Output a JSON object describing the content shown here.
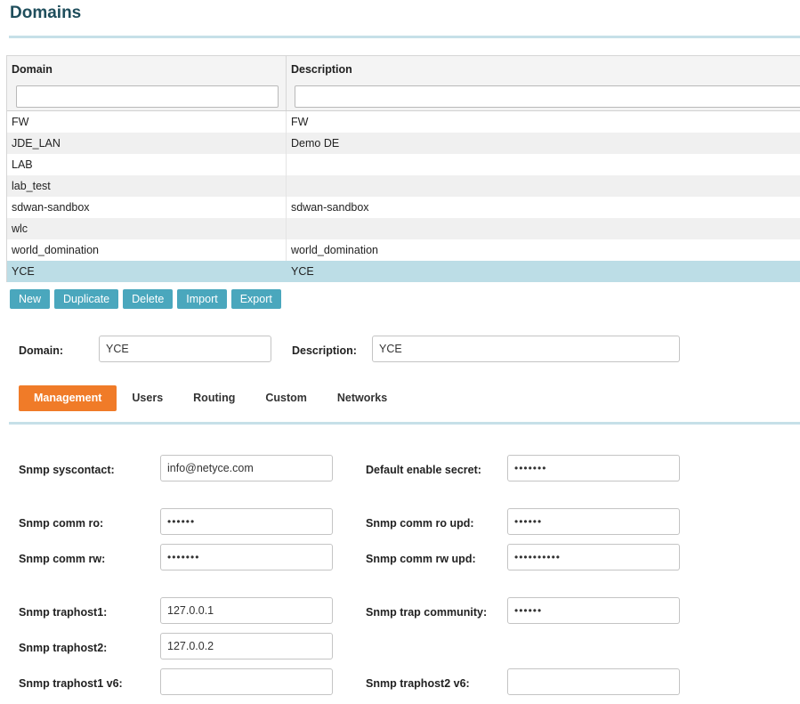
{
  "page": {
    "title": "Domains"
  },
  "grid": {
    "columns": [
      "Domain",
      "Description"
    ],
    "filters": [
      "",
      ""
    ],
    "rows": [
      {
        "domain": "FW",
        "description": "FW"
      },
      {
        "domain": "JDE_LAN",
        "description": "Demo DE"
      },
      {
        "domain": "LAB",
        "description": ""
      },
      {
        "domain": "lab_test",
        "description": ""
      },
      {
        "domain": "sdwan-sandbox",
        "description": "sdwan-sandbox"
      },
      {
        "domain": "wlc",
        "description": ""
      },
      {
        "domain": "world_domination",
        "description": "world_domination"
      },
      {
        "domain": "YCE",
        "description": "YCE",
        "selected": true
      }
    ]
  },
  "toolbar": {
    "new": "New",
    "duplicate": "Duplicate",
    "delete": "Delete",
    "import": "Import",
    "export": "Export"
  },
  "detail": {
    "domain_label": "Domain:",
    "domain_value": "YCE",
    "description_label": "Description:",
    "description_value": "YCE"
  },
  "tabs": [
    "Management",
    "Users",
    "Routing",
    "Custom",
    "Networks"
  ],
  "active_tab": "Management",
  "management": {
    "syscontact_label": "Snmp syscontact:",
    "syscontact_value": "info@netyce.com",
    "enable_secret_label": "Default enable secret:",
    "enable_secret_value": "•••••••",
    "comm_ro_label": "Snmp comm ro:",
    "comm_ro_value": "••••••",
    "comm_ro_upd_label": "Snmp comm ro upd:",
    "comm_ro_upd_value": "••••••",
    "comm_rw_label": "Snmp comm rw:",
    "comm_rw_value": "•••••••",
    "comm_rw_upd_label": "Snmp comm rw upd:",
    "comm_rw_upd_value": "••••••••••",
    "traphost1_label": "Snmp traphost1:",
    "traphost1_value": "127.0.0.1",
    "trap_community_label": "Snmp trap community:",
    "trap_community_value": "••••••",
    "traphost2_label": "Snmp traphost2:",
    "traphost2_value": "127.0.0.2",
    "traphost1_v6_label": "Snmp traphost1 v6:",
    "traphost1_v6_value": "",
    "traphost2_v6_label": "Snmp traphost2 v6:",
    "traphost2_v6_value": ""
  }
}
